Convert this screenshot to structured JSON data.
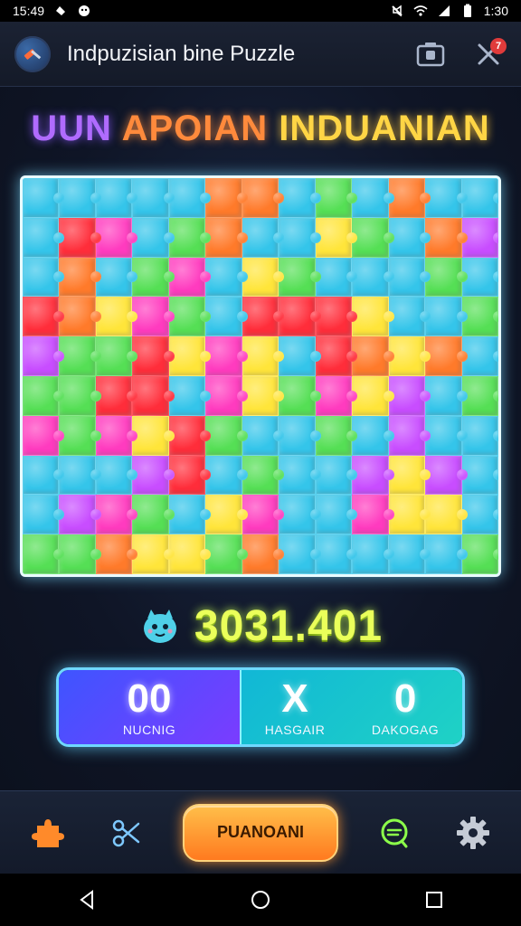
{
  "status_bar": {
    "time": "15:49",
    "right_time": "1:30"
  },
  "app_bar": {
    "title": "Indpuzisian bine Puzzle",
    "badge": "7"
  },
  "headline": {
    "part_a": "UUN",
    "part_b": "APOIAN",
    "part_c": "INDUANIAN"
  },
  "puzzle": {
    "colors": [
      "#34c5ea",
      "#34c5ea",
      "#34c5ea",
      "#34c5ea",
      "#34c5ea",
      "#ff7a2a",
      "#ff7a2a",
      "#34c5ea",
      "#55df55",
      "#34c5ea",
      "#ff7a2a",
      "#34c5ea",
      "#34c5ea",
      "#34c5ea",
      "#ff2d3a",
      "#ff3bbf",
      "#34c5ea",
      "#55df55",
      "#ff7a2a",
      "#34c5ea",
      "#34c5ea",
      "#ffe53a",
      "#55df55",
      "#34c5ea",
      "#ff7a2a",
      "#c84dff",
      "#34c5ea",
      "#ff7a2a",
      "#34c5ea",
      "#55df55",
      "#ff3bbf",
      "#34c5ea",
      "#ffe53a",
      "#55df55",
      "#34c5ea",
      "#34c5ea",
      "#34c5ea",
      "#55df55",
      "#34c5ea",
      "#ff2d3a",
      "#ff7a2a",
      "#ffe53a",
      "#ff3bbf",
      "#55df55",
      "#34c5ea",
      "#ff2d3a",
      "#ff2d3a",
      "#ff2d3a",
      "#ffe53a",
      "#34c5ea",
      "#34c5ea",
      "#55df55",
      "#c84dff",
      "#55df55",
      "#55df55",
      "#ff2d3a",
      "#ffe53a",
      "#ff3bbf",
      "#ffe53a",
      "#34c5ea",
      "#ff2d3a",
      "#ff7a2a",
      "#ffe53a",
      "#ff7a2a",
      "#34c5ea",
      "#55df55",
      "#55df55",
      "#ff2d3a",
      "#ff2d3a",
      "#34c5ea",
      "#ff3bbf",
      "#ffe53a",
      "#55df55",
      "#ff3bbf",
      "#ffe53a",
      "#c84dff",
      "#34c5ea",
      "#55df55",
      "#ff3bbf",
      "#55df55",
      "#ff3bbf",
      "#ffe53a",
      "#ff2d3a",
      "#55df55",
      "#34c5ea",
      "#34c5ea",
      "#55df55",
      "#34c5ea",
      "#c84dff",
      "#34c5ea",
      "#34c5ea",
      "#34c5ea",
      "#34c5ea",
      "#34c5ea",
      "#c84dff",
      "#ff2d3a",
      "#34c5ea",
      "#55df55",
      "#34c5ea",
      "#34c5ea",
      "#c84dff",
      "#ffe53a",
      "#c84dff",
      "#34c5ea",
      "#34c5ea",
      "#c84dff",
      "#ff3bbf",
      "#55df55",
      "#34c5ea",
      "#ffe53a",
      "#ff3bbf",
      "#34c5ea",
      "#34c5ea",
      "#ff3bbf",
      "#ffe53a",
      "#ffe53a",
      "#34c5ea",
      "#55df55",
      "#55df55",
      "#ff7a2a",
      "#ffe53a",
      "#ffe53a",
      "#55df55",
      "#ff7a2a",
      "#34c5ea",
      "#34c5ea",
      "#34c5ea",
      "#34c5ea",
      "#34c5ea",
      "#55df55"
    ]
  },
  "score": {
    "value": "3031.401"
  },
  "stats": {
    "left": {
      "value": "00",
      "label": "NUCNIG"
    },
    "middle": {
      "value": "X",
      "label": "HASGAIR"
    },
    "right": {
      "value": "0",
      "label": "DAKOGAG"
    }
  },
  "bottom_bar": {
    "primary_label": "PUANOANI"
  },
  "colors": {
    "accent_orange": "#ff8a2a",
    "accent_green": "#eaff5a",
    "panel_blue": "#3e55ff",
    "panel_teal": "#11b7d6"
  }
}
